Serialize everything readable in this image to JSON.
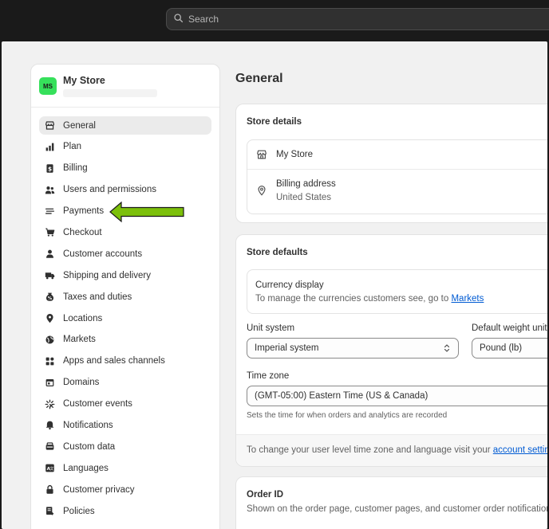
{
  "search": {
    "placeholder": "Search"
  },
  "store": {
    "initials": "MS",
    "name": "My Store"
  },
  "sidebar": {
    "items": [
      {
        "label": "General",
        "icon": "store-icon",
        "active": true
      },
      {
        "label": "Plan",
        "icon": "chart-icon"
      },
      {
        "label": "Billing",
        "icon": "billing-icon"
      },
      {
        "label": "Users and permissions",
        "icon": "users-icon"
      },
      {
        "label": "Payments",
        "icon": "payments-icon"
      },
      {
        "label": "Checkout",
        "icon": "cart-icon"
      },
      {
        "label": "Customer accounts",
        "icon": "person-icon"
      },
      {
        "label": "Shipping and delivery",
        "icon": "truck-icon"
      },
      {
        "label": "Taxes and duties",
        "icon": "tax-icon"
      },
      {
        "label": "Locations",
        "icon": "location-icon"
      },
      {
        "label": "Markets",
        "icon": "globe-icon"
      },
      {
        "label": "Apps and sales channels",
        "icon": "apps-icon"
      },
      {
        "label": "Domains",
        "icon": "domain-icon"
      },
      {
        "label": "Customer events",
        "icon": "events-icon"
      },
      {
        "label": "Notifications",
        "icon": "bell-icon"
      },
      {
        "label": "Custom data",
        "icon": "database-icon"
      },
      {
        "label": "Languages",
        "icon": "language-icon"
      },
      {
        "label": "Customer privacy",
        "icon": "lock-icon"
      },
      {
        "label": "Policies",
        "icon": "policy-icon"
      }
    ]
  },
  "main": {
    "title": "General",
    "store_details": {
      "title": "Store details",
      "store_name": "My Store",
      "billing_label": "Billing address",
      "billing_value": "United States"
    },
    "store_defaults": {
      "title": "Store defaults",
      "currency_title": "Currency display",
      "currency_desc": "To manage the currencies customers see, go to",
      "currency_link": "Markets",
      "unit_system_label": "Unit system",
      "unit_system_value": "Imperial system",
      "weight_label": "Default weight unit",
      "weight_value": "Pound (lb)",
      "timezone_label": "Time zone",
      "timezone_value": "(GMT-05:00) Eastern Time (US & Canada)",
      "timezone_help": "Sets the time for when orders and analytics are recorded",
      "footer_text": "To change your user level time zone and language visit your",
      "footer_link": "account settings"
    },
    "order_id": {
      "title": "Order ID",
      "desc": "Shown on the order page, customer pages, and customer order notifications"
    }
  },
  "colors": {
    "accent_link": "#005bd3",
    "avatar_bg": "#36e05b",
    "arrow": "#7cc00a"
  }
}
